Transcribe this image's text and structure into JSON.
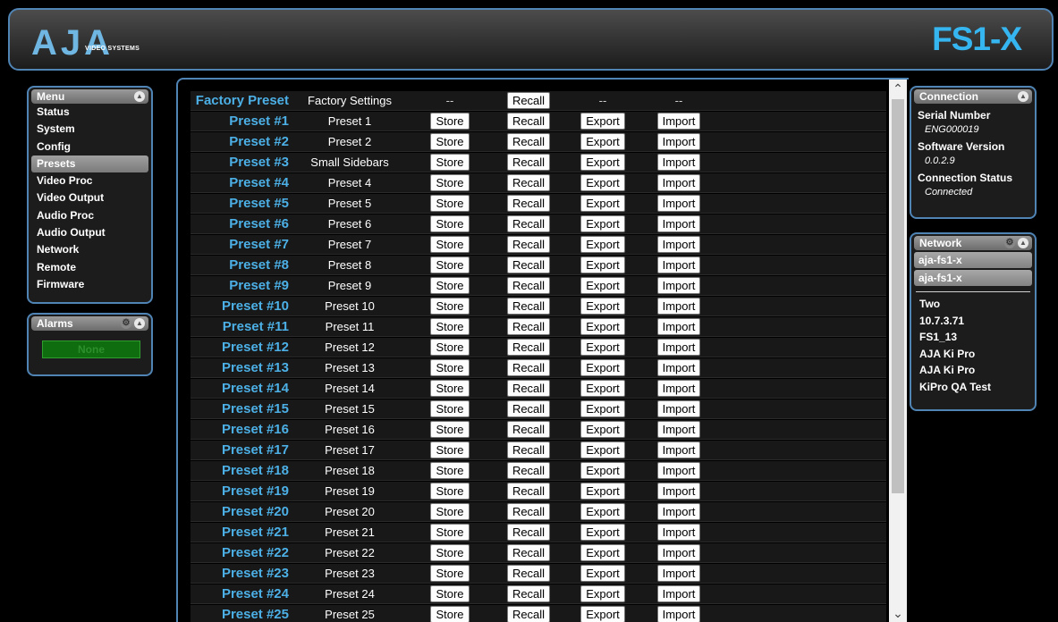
{
  "header": {
    "logo_text": "AJA",
    "logo_subtitle": "VIDEO SYSTEMS",
    "product_name": "FS1-X"
  },
  "menu": {
    "title": "Menu",
    "items": [
      "Status",
      "System",
      "Config",
      "Presets",
      "Video Proc",
      "Video Output",
      "Audio Proc",
      "Audio Output",
      "Network",
      "Remote",
      "Firmware"
    ],
    "active_item": "Presets"
  },
  "alarms": {
    "title": "Alarms",
    "status": "None"
  },
  "presets": {
    "factory": {
      "name": "Factory Preset",
      "label": "Factory Settings",
      "store": "--",
      "recall": "Recall",
      "export": "--",
      "import": "--"
    },
    "buttons": {
      "store": "Store",
      "recall": "Recall",
      "export": "Export",
      "import": "Import"
    },
    "rows": [
      {
        "name": "Preset #1",
        "label": "Preset 1"
      },
      {
        "name": "Preset #2",
        "label": "Preset 2"
      },
      {
        "name": "Preset #3",
        "label": "Small Sidebars"
      },
      {
        "name": "Preset #4",
        "label": "Preset 4"
      },
      {
        "name": "Preset #5",
        "label": "Preset 5"
      },
      {
        "name": "Preset #6",
        "label": "Preset 6"
      },
      {
        "name": "Preset #7",
        "label": "Preset 7"
      },
      {
        "name": "Preset #8",
        "label": "Preset 8"
      },
      {
        "name": "Preset #9",
        "label": "Preset 9"
      },
      {
        "name": "Preset #10",
        "label": "Preset 10"
      },
      {
        "name": "Preset #11",
        "label": "Preset 11"
      },
      {
        "name": "Preset #12",
        "label": "Preset 12"
      },
      {
        "name": "Preset #13",
        "label": "Preset 13"
      },
      {
        "name": "Preset #14",
        "label": "Preset 14"
      },
      {
        "name": "Preset #15",
        "label": "Preset 15"
      },
      {
        "name": "Preset #16",
        "label": "Preset 16"
      },
      {
        "name": "Preset #17",
        "label": "Preset 17"
      },
      {
        "name": "Preset #18",
        "label": "Preset 18"
      },
      {
        "name": "Preset #19",
        "label": "Preset 19"
      },
      {
        "name": "Preset #20",
        "label": "Preset 20"
      },
      {
        "name": "Preset #21",
        "label": "Preset 21"
      },
      {
        "name": "Preset #22",
        "label": "Preset 22"
      },
      {
        "name": "Preset #23",
        "label": "Preset 23"
      },
      {
        "name": "Preset #24",
        "label": "Preset 24"
      },
      {
        "name": "Preset #25",
        "label": "Preset 25"
      }
    ]
  },
  "connection": {
    "title": "Connection",
    "serial_label": "Serial Number",
    "serial_value": "ENG000019",
    "version_label": "Software Version",
    "version_value": "0.0.2.9",
    "status_label": "Connection Status",
    "status_value": "Connected"
  },
  "network": {
    "title": "Network",
    "selected": [
      "aja-fs1-x",
      "aja-fs1-x"
    ],
    "items": [
      "Two",
      "10.7.3.71",
      "FS1_13",
      "AJA Ki Pro",
      "AJA Ki Pro",
      "KiPro QA Test"
    ]
  },
  "colors": {
    "accent_blue": "#36b6f1",
    "panel_border": "#4f84b4",
    "preset_name": "#4cb0e6",
    "alarm_green": "#0f6d0f"
  }
}
